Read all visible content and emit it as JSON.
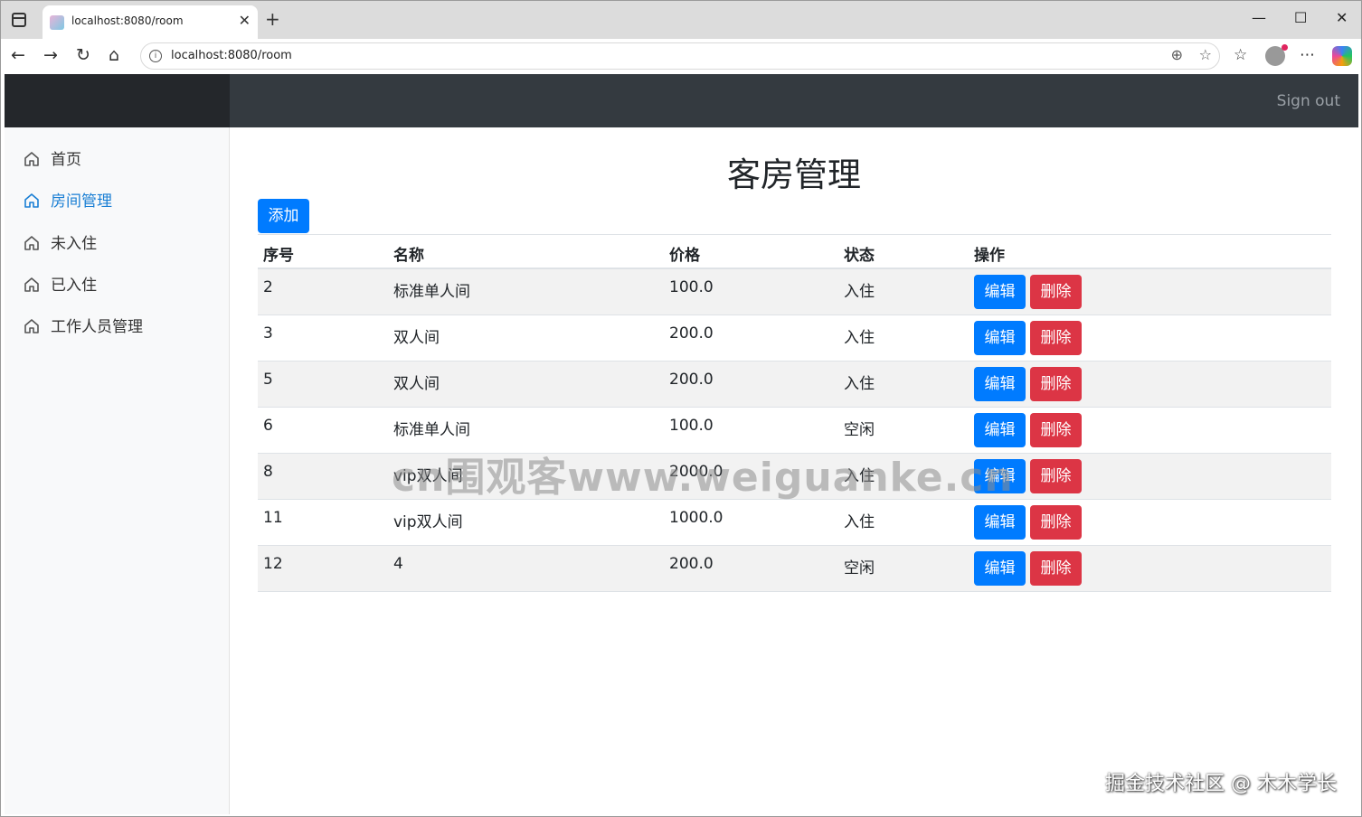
{
  "browser": {
    "tab_title": "localhost:8080/room",
    "url": "localhost:8080/room"
  },
  "navbar": {
    "sign_out": "Sign out"
  },
  "sidebar": {
    "items": [
      {
        "label": "首页",
        "active": false,
        "icon": "home-icon"
      },
      {
        "label": "房间管理",
        "active": true,
        "icon": "home-icon"
      },
      {
        "label": "未入住",
        "active": false,
        "icon": "home-icon"
      },
      {
        "label": "已入住",
        "active": false,
        "icon": "home-icon"
      },
      {
        "label": "工作人员管理",
        "active": false,
        "icon": "home-icon"
      }
    ]
  },
  "main": {
    "title": "客房管理",
    "add_button": "添加",
    "table": {
      "headers": [
        "序号",
        "名称",
        "价格",
        "状态",
        "操作"
      ],
      "rows": [
        {
          "id": "2",
          "name": "标准单人间",
          "price": "100.0",
          "status": "入住"
        },
        {
          "id": "3",
          "name": "双人间",
          "price": "200.0",
          "status": "入住"
        },
        {
          "id": "5",
          "name": "双人间",
          "price": "200.0",
          "status": "入住"
        },
        {
          "id": "6",
          "name": "标准单人间",
          "price": "100.0",
          "status": "空闲"
        },
        {
          "id": "8",
          "name": "vip双人间",
          "price": "2000.0",
          "status": "入住"
        },
        {
          "id": "11",
          "name": "vip双人间",
          "price": "1000.0",
          "status": "入住"
        },
        {
          "id": "12",
          "name": "4",
          "price": "200.0",
          "status": "空闲"
        }
      ],
      "edit_label": "编辑",
      "delete_label": "删除"
    }
  },
  "overlay": {
    "watermark": "cn围观客www.weiguanke.cn",
    "credit": "掘金技术社区 @ 木木学长"
  },
  "colors": {
    "navbar": "#343a40",
    "primary": "#007bff",
    "danger": "#dc3545",
    "sidebar_active": "#1a7fd4"
  }
}
